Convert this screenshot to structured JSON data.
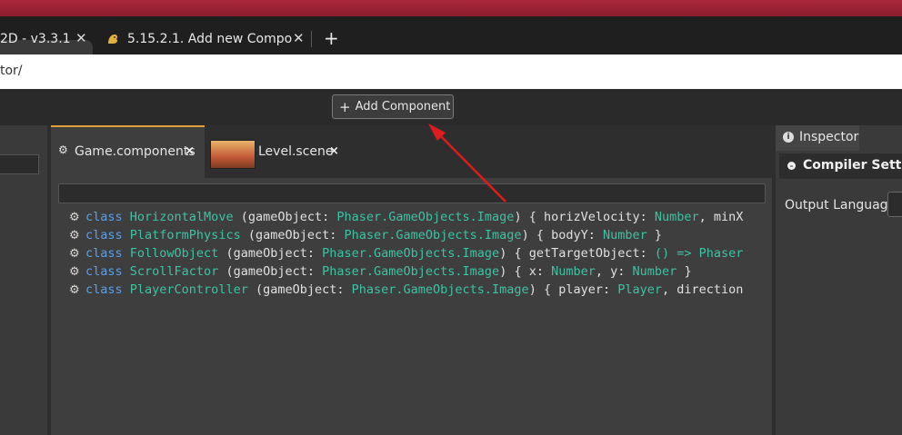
{
  "browser": {
    "tabs": [
      {
        "title": "2D - v3.3.1",
        "close": "✕",
        "active": true
      },
      {
        "title": "5.15.2.1. Add new Compo",
        "close": "✕",
        "active": false
      }
    ],
    "new_tab": "+",
    "url": "tor/"
  },
  "toolbar": {
    "add_component_label": "Add Component",
    "add_icon": "+"
  },
  "editor": {
    "tabs": [
      {
        "label": "Game.components",
        "close": "×",
        "icon": "component-icon"
      },
      {
        "label": "Level.scene",
        "close": "×",
        "icon": "scene-thumbnail"
      }
    ],
    "filter_value": "",
    "lines": [
      {
        "kw": "class",
        "name": "HorizontalMove",
        "p1": " (gameObject: ",
        "type": "Phaser.GameObjects.Image",
        "p2": ") { horizVelocity: ",
        "t2": "Number",
        "p3": ", minX"
      },
      {
        "kw": "class",
        "name": "PlatformPhysics",
        "p1": " (gameObject: ",
        "type": "Phaser.GameObjects.Image",
        "p2": ") { bodyY: ",
        "t2": "Number",
        "p3": " }"
      },
      {
        "kw": "class",
        "name": "FollowObject",
        "p1": " (gameObject: ",
        "type": "Phaser.GameObjects.Image",
        "p2": ") { getTargetObject: ",
        "t2": "() => Phaser",
        "p3": ""
      },
      {
        "kw": "class",
        "name": "ScrollFactor",
        "p1": " (gameObject: ",
        "type": "Phaser.GameObjects.Image",
        "p2": ") { x: ",
        "t2": "Number",
        "p3": ", y: ",
        "t3": "Number",
        "p4": " }"
      },
      {
        "kw": "class",
        "name": "PlayerController",
        "p1": " (gameObject: ",
        "type": "Phaser.GameObjects.Image",
        "p2": ") { player: ",
        "t2": "Player",
        "p3": ", direction"
      }
    ]
  },
  "inspector": {
    "tab_label": "Inspector",
    "section_label": "Compiler Setting",
    "output_language_label": "Output Language"
  },
  "colors": {
    "keyword": "#5f9fe0",
    "type": "#3ec2a3",
    "tab_accent": "#e0a13a",
    "annotation_arrow": "#e01b1b"
  }
}
